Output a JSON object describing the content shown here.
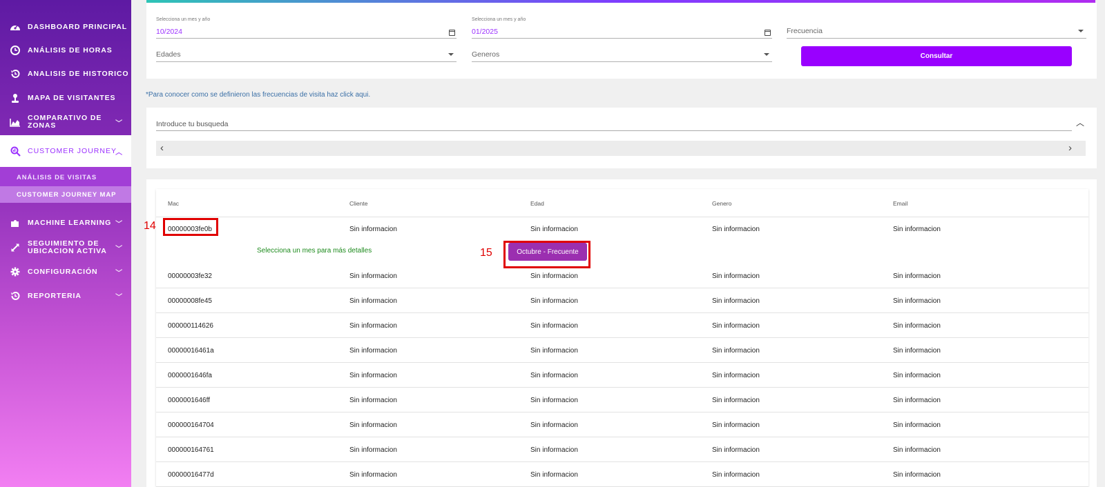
{
  "sidebar": {
    "items": [
      {
        "label": "DASHBOARD PRINCIPAL",
        "icon": "dashboard-icon"
      },
      {
        "label": "ANÁLISIS DE HORAS",
        "icon": "clock-icon"
      },
      {
        "label": "ANALISIS DE HISTORICO",
        "icon": "history-icon"
      },
      {
        "label": "MAPA DE VISITANTES",
        "icon": "map-pin-icon"
      },
      {
        "label_line1": "COMPARATIVO DE",
        "label_line2": "ZONAS",
        "icon": "area-chart-icon"
      },
      {
        "label": "CUSTOMER JOURNEY",
        "icon": "search-analytics-icon"
      },
      {
        "label": "MACHINE LEARNING",
        "icon": "puzzle-icon"
      },
      {
        "label_line1": "SEGUIMIENTO DE",
        "label_line2": "UBICACION ACTIVA",
        "icon": "expand-arrows-icon"
      },
      {
        "label": "CONFIGURACIÓN",
        "icon": "gear-icon"
      },
      {
        "label": "REPORTERIA",
        "icon": "history-icon"
      }
    ],
    "subitems": [
      {
        "label": "ANÁLISIS DE VISITAS"
      },
      {
        "label": "CUSTOMER JOURNEY MAP"
      }
    ]
  },
  "filters": {
    "start": {
      "label": "Selecciona un mes y año",
      "value": "10/2024"
    },
    "end": {
      "label": "Selecciona un mes y año",
      "value": "01/2025"
    },
    "frecuencia": {
      "placeholder": "Frecuencia"
    },
    "edades": {
      "placeholder": "Edades"
    },
    "generos": {
      "placeholder": "Generos"
    },
    "consultar_label": "Consultar"
  },
  "help_link": "*Para conocer como se definieron las frecuencias de visita haz click aqui.",
  "search": {
    "placeholder": "Introduce tu busqueda"
  },
  "table": {
    "headers": [
      "Mac",
      "Cliente",
      "Edad",
      "Genero",
      "Email"
    ],
    "first_row": [
      "00000003fe0b",
      "Sin informacion",
      "Sin informacion",
      "Sin informacion",
      "Sin informacion"
    ],
    "detail_text": "Selecciona un mes para más detalles",
    "detail_button": "Octubre - Frecuente",
    "rows": [
      [
        "00000003fe32",
        "Sin informacion",
        "Sin informacion",
        "Sin informacion",
        "Sin informacion"
      ],
      [
        "00000008fe45",
        "Sin informacion",
        "Sin informacion",
        "Sin informacion",
        "Sin informacion"
      ],
      [
        "000000114626",
        "Sin informacion",
        "Sin informacion",
        "Sin informacion",
        "Sin informacion"
      ],
      [
        "00000016461a",
        "Sin informacion",
        "Sin informacion",
        "Sin informacion",
        "Sin informacion"
      ],
      [
        "0000001646fa",
        "Sin informacion",
        "Sin informacion",
        "Sin informacion",
        "Sin informacion"
      ],
      [
        "0000001646ff",
        "Sin informacion",
        "Sin informacion",
        "Sin informacion",
        "Sin informacion"
      ],
      [
        "000000164704",
        "Sin informacion",
        "Sin informacion",
        "Sin informacion",
        "Sin informacion"
      ],
      [
        "000000164761",
        "Sin informacion",
        "Sin informacion",
        "Sin informacion",
        "Sin informacion"
      ],
      [
        "00000016477d",
        "Sin informacion",
        "Sin informacion",
        "Sin informacion",
        "Sin informacion"
      ]
    ]
  },
  "annotations": {
    "a14": "14",
    "a15": "15"
  },
  "colors": {
    "accent": "#9900ff",
    "annotation": "#e00000",
    "link": "#3a6fa6",
    "detail_text": "#1c8a1c"
  }
}
